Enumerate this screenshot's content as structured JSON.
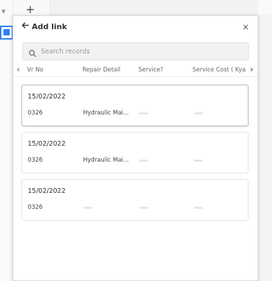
{
  "background": {
    "dropdown_icon": "caret-down-icon",
    "add_column_symbol": "+"
  },
  "dialog": {
    "title": "Add link",
    "back_icon": "arrow-left-icon",
    "close_symbol": "×",
    "search": {
      "placeholder": "Search records",
      "value": ""
    },
    "columns": [
      "Vr No",
      "Repair Detail",
      "Service?",
      "Service Cost ( Kya"
    ],
    "records": [
      {
        "date": "15/02/2022",
        "vr_no": "0326",
        "repair_detail": "Hydraulic Mai...",
        "service": "",
        "service_cost": ""
      },
      {
        "date": "15/02/2022",
        "vr_no": "0326",
        "repair_detail": "Hydraulic Mai...",
        "service": "",
        "service_cost": ""
      },
      {
        "date": "15/02/2022",
        "vr_no": "0326",
        "repair_detail": "",
        "service": "",
        "service_cost": ""
      }
    ]
  },
  "colors": {
    "accent": "#2d7ff9",
    "empty_placeholder": "#e6e6e6"
  }
}
